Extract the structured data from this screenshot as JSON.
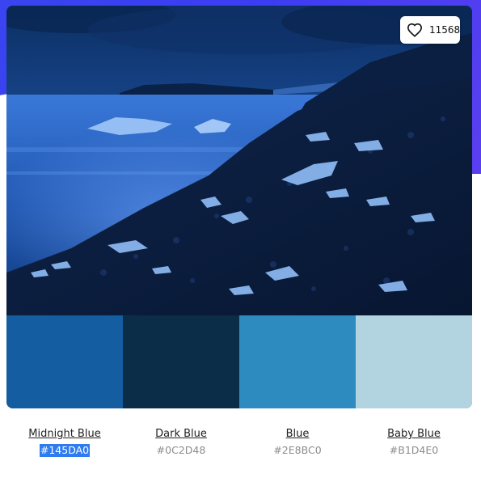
{
  "like": {
    "count": "11568",
    "icon": "heart-icon"
  },
  "palette": {
    "colors": [
      {
        "name": "Midnight Blue",
        "hex": "#145DA0",
        "selected": true
      },
      {
        "name": "Dark Blue",
        "hex": "#0C2D48",
        "selected": false
      },
      {
        "name": "Blue",
        "hex": "#2E8BC0",
        "selected": false
      },
      {
        "name": "Baby Blue",
        "hex": "#B1D4E0",
        "selected": false
      }
    ]
  }
}
